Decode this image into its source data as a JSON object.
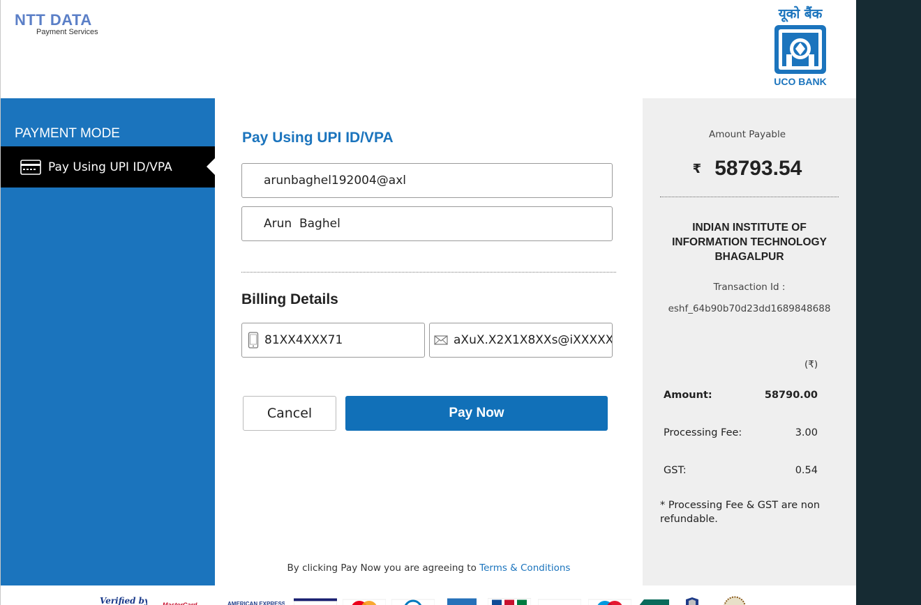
{
  "header": {
    "ntt_logo_main": "NTT DATA",
    "ntt_logo_sub": "Payment Services",
    "bank_logo_hindi": "यूको बैंक",
    "bank_logo_name": "UCO BANK"
  },
  "sidebar": {
    "title": "PAYMENT MODE",
    "items": [
      {
        "label": "Pay Using UPI ID/VPA",
        "icon": "card-icon",
        "active": true
      }
    ]
  },
  "main": {
    "section_title": "Pay Using UPI ID/VPA",
    "vpa_value": "arunbaghel192004@axl",
    "name_value": "Arun  Baghel",
    "billing_title": "Billing Details",
    "phone_value": "81XX4XXX71",
    "email_value": "aXuX.X2X1X8XXs@iXXXXXX",
    "cancel_label": "Cancel",
    "pay_label": "Pay Now",
    "terms_prefix": "By clicking Pay Now you are agreeing to",
    "terms_link": "Terms & Conditions"
  },
  "summary": {
    "amount_payable_label": "Amount Payable",
    "currency_symbol": "₹",
    "amount_payable": "58793.54",
    "merchant_line1": "INDIAN INSTITUTE OF",
    "merchant_line2": "INFORMATION TECHNOLOGY",
    "merchant_line3": "BHAGALPUR",
    "transaction_label": "Transaction Id :",
    "transaction_id": "eshf_64b90b70d23dd1689848688",
    "currency_note": "(₹)",
    "amount_label": "Amount:",
    "amount_value": "58790.00",
    "fee_label": "Processing Fee:",
    "fee_value": "3.00",
    "gst_label": "GST:",
    "gst_value": "0.54",
    "note": "* Processing Fee & GST are non refundable."
  },
  "card_strip": {
    "logos": [
      "verified-by-visa",
      "mastercard",
      "american-express",
      "visa",
      "mastercard-circles",
      "diners-club",
      "amex-blue",
      "jcb",
      "rupay",
      "maestro",
      "netbanking",
      "shield",
      "seal"
    ]
  },
  "colors": {
    "primary": "#1b74bd",
    "button": "#1170b8",
    "sidebar_active": "#000000",
    "summary_bg": "#efefef",
    "outer_bg": "#162b33"
  }
}
